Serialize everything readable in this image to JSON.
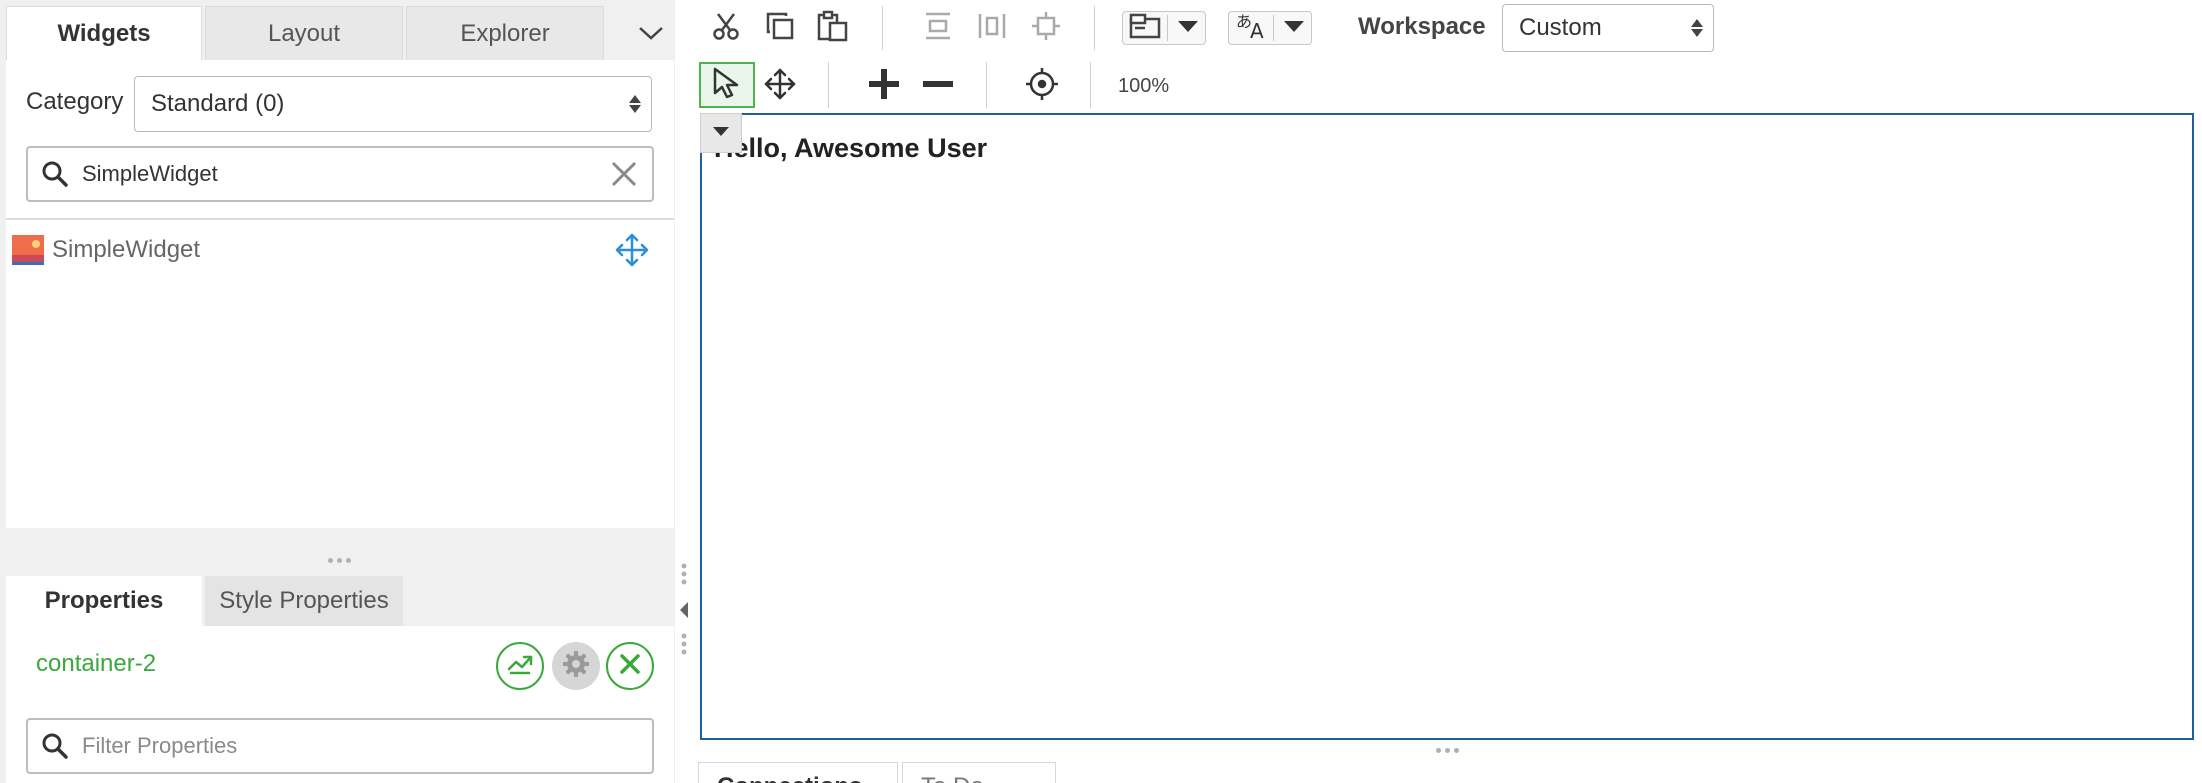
{
  "left_panel": {
    "tabs": [
      {
        "label": "Widgets",
        "active": true
      },
      {
        "label": "Layout",
        "active": false
      },
      {
        "label": "Explorer",
        "active": false
      }
    ],
    "category_label": "Category",
    "category_value": "Standard (0)",
    "search_value": "SimpleWidget",
    "widget_list": [
      {
        "name": "SimpleWidget",
        "icon": "widget-image-icon"
      }
    ]
  },
  "properties_panel": {
    "tabs": [
      {
        "label": "Properties",
        "active": true
      },
      {
        "label": "Style Properties",
        "active": false
      }
    ],
    "selected_name": "container-2",
    "filter_placeholder": "Filter Properties"
  },
  "toolbar": {
    "icons": [
      "cut-icon",
      "copy-icon",
      "paste-icon",
      "distribute-horizontal-icon",
      "distribute-vertical-icon",
      "center-icon",
      "layout-icon",
      "language-icon",
      "select-icon",
      "move-icon",
      "plus-icon",
      "minus-icon",
      "target-icon"
    ],
    "workspace_label": "Workspace",
    "workspace_value": "Custom",
    "zoom": "100%"
  },
  "canvas": {
    "text": "Hello, Awesome User"
  },
  "bottom_tabs": [
    {
      "label": "Connections"
    },
    {
      "label": "To Do"
    }
  ],
  "colors": {
    "accent_green": "#3aa83a",
    "canvas_border": "#1f5f9c",
    "move_blue": "#2a8fd6"
  }
}
